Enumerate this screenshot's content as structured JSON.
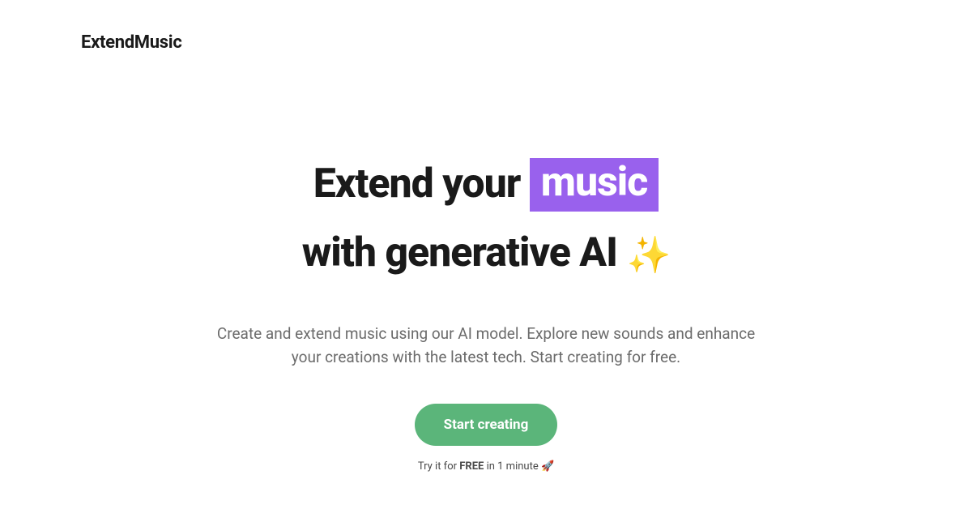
{
  "header": {
    "logo": "ExtendMusic"
  },
  "hero": {
    "headline_part1": "Extend your ",
    "headline_highlight": "music",
    "headline_part2": "with generative AI ",
    "headline_emoji": "✨",
    "subtext": "Create and extend music using our AI model. Explore new sounds and enhance your creations with the latest tech. Start creating for free.",
    "cta_label": "Start creating",
    "try_prefix": "Try it for ",
    "try_bold": "FREE",
    "try_suffix": " in 1 minute 🚀"
  }
}
